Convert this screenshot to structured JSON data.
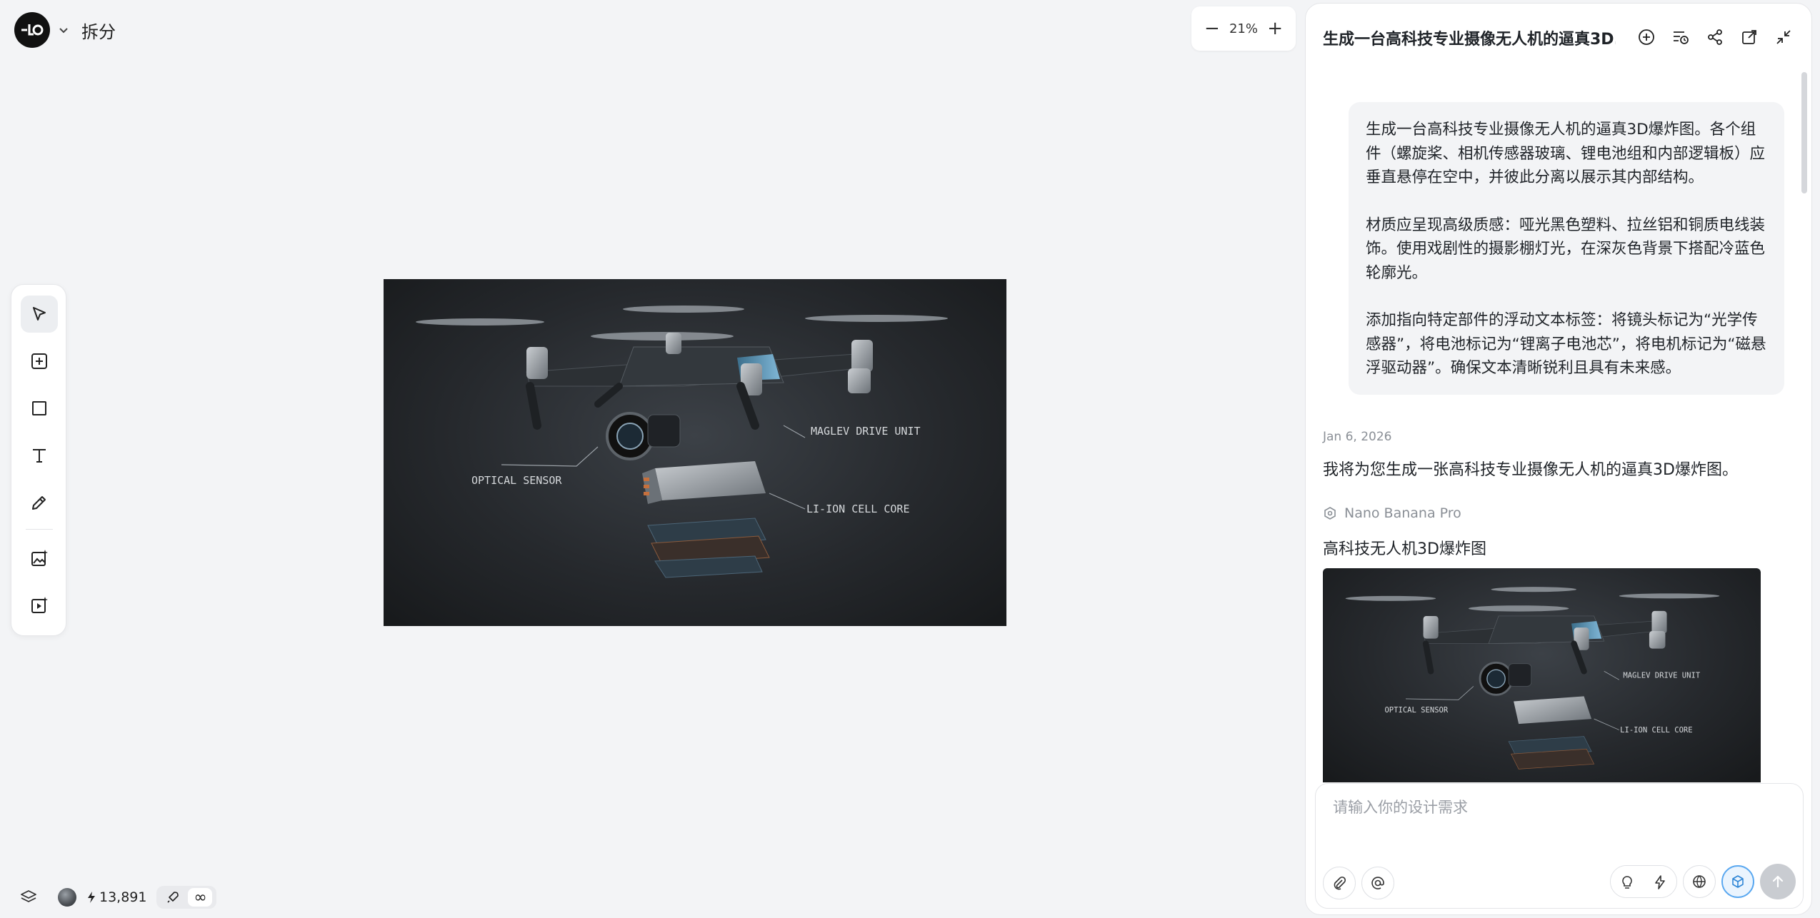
{
  "project": {
    "name": "拆分"
  },
  "zoom": {
    "minus": "−",
    "level": "21%",
    "plus": "+"
  },
  "canvas": {
    "image_labels": {
      "optical": "OPTICAL SENSOR",
      "maglev": "MAGLEV DRIVE UNIT",
      "cell": "LI-ION CELL CORE"
    }
  },
  "status": {
    "credits": "13,891",
    "infinite": "∞"
  },
  "panel": {
    "title": "生成一台高科技专业摄像无人机的逼真3D...",
    "prompt": {
      "p1": "生成一台高科技专业摄像无人机的逼真3D爆炸图。各个组件（螺旋桨、相机传感器玻璃、锂电池组和内部逻辑板）应垂直悬停在空中，并彼此分离以展示其内部结构。",
      "p2": "材质应呈现高级质感：哑光黑色塑料、拉丝铝和铜质电线装饰。使用戏剧性的摄影棚灯光，在深灰色背景下搭配冷蓝色轮廓光。",
      "p3": "添加指向特定部件的浮动文本标签：将镜头标记为“光学传感器”，将电池标记为“锂离子电池芯”，将电机标记为“磁悬浮驱动器”。确保文本清晰锐利且具有未来感。"
    },
    "date": "Jan 6, 2026",
    "reply": "我将为您生成一张高科技专业摄像无人机的逼真3D爆炸图。",
    "model": "Nano Banana Pro",
    "result_title": "高科技无人机3D爆炸图"
  },
  "composer": {
    "placeholder": "请输入你的设计需求"
  }
}
